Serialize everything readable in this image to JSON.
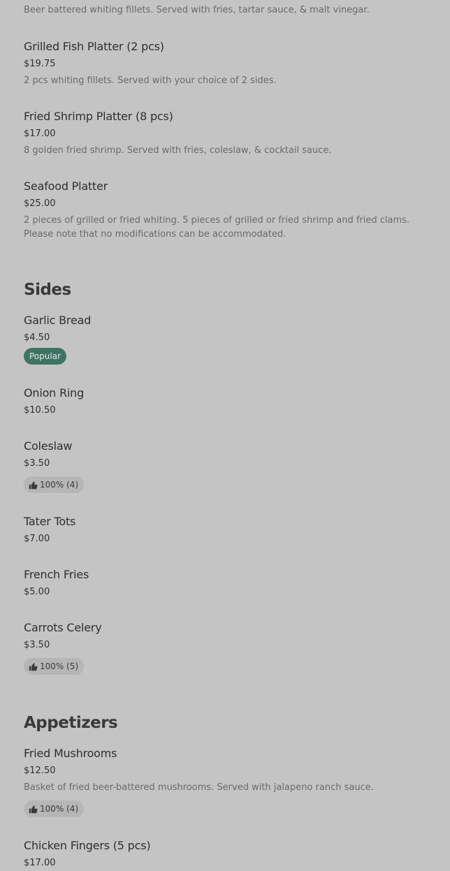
{
  "seafood": {
    "partial_desc": "Beer battered whiting fillets. Served with fries, tartar sauce, & malt vinegar.",
    "items": [
      {
        "name": "Grilled Fish Platter (2 pcs)",
        "price": "$19.75",
        "desc": "2 pcs whiting fillets. Served with your choice of 2 sides."
      },
      {
        "name": "Fried Shrimp Platter (8 pcs)",
        "price": "$17.00",
        "desc": "8 golden fried shrimp. Served with fries, coleslaw, & cocktail sauce."
      },
      {
        "name": "Seafood Platter",
        "price": "$25.00",
        "desc": "2 pieces of grilled or fried whiting. 5 pieces of grilled or fried shrimp and fried clams. Please note that no modifications can be accommodated."
      }
    ]
  },
  "sides": {
    "title": "Sides",
    "items": [
      {
        "name": "Garlic Bread",
        "price": "$4.50",
        "badge": "Popular"
      },
      {
        "name": "Onion Ring",
        "price": "$10.50"
      },
      {
        "name": "Coleslaw",
        "price": "$3.50",
        "rating": "100% (4)"
      },
      {
        "name": "Tater Tots",
        "price": "$7.00"
      },
      {
        "name": "French Fries",
        "price": "$5.00"
      },
      {
        "name": "Carrots Celery",
        "price": "$3.50",
        "rating": "100% (5)"
      }
    ]
  },
  "appetizers": {
    "title": "Appetizers",
    "items": [
      {
        "name": "Fried Mushrooms",
        "price": "$12.50",
        "desc": "Basket of fried beer-battered mushrooms. Served with jalapeno ranch sauce.",
        "rating": "100% (4)"
      },
      {
        "name": "Chicken Fingers (5 pcs)",
        "price": "$17.00"
      }
    ]
  },
  "icons": {
    "rating": "thumbs-up-icon"
  }
}
